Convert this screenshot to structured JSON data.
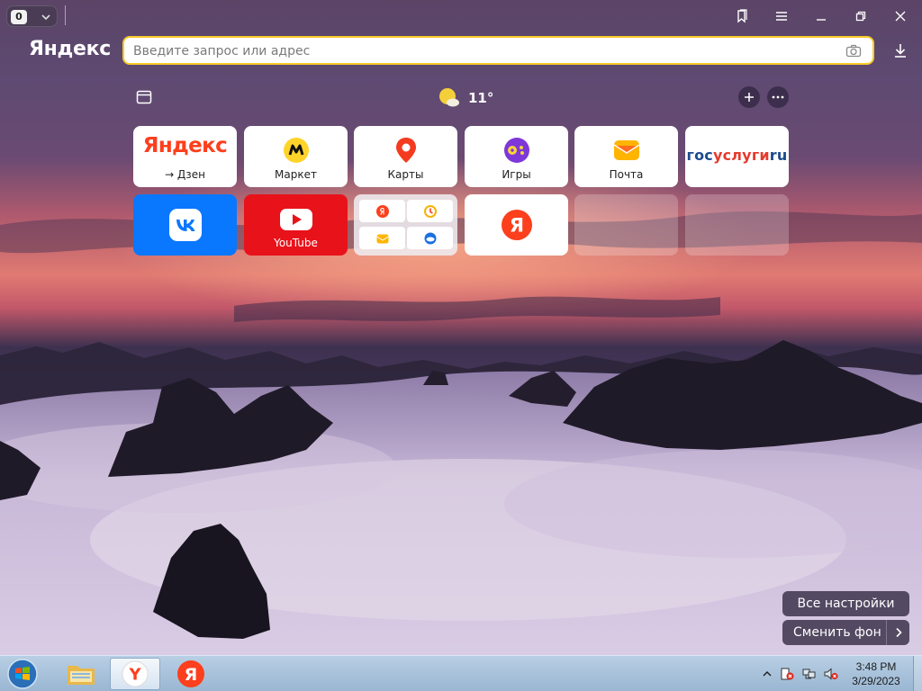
{
  "tab_counter": {
    "count": "0"
  },
  "window_controls": [
    "bookmarks",
    "menu",
    "minimize",
    "restore",
    "close"
  ],
  "header": {
    "brand": "Яндекс",
    "search": {
      "placeholder": "Введите запрос или адрес",
      "value": ""
    }
  },
  "weather": {
    "temperature": "11°",
    "icon": "sun-cloud-icon"
  },
  "tiles": [
    {
      "label": "→ Дзен",
      "logo_text": "Яндекс",
      "icon": "yandex-wordmark"
    },
    {
      "label": "Маркет",
      "icon": "market-icon"
    },
    {
      "label": "Карты",
      "icon": "map-pin-icon"
    },
    {
      "label": "Игры",
      "icon": "gamepad-icon"
    },
    {
      "label": "Почта",
      "icon": "mail-icon"
    },
    {
      "logo_text_a": "гос",
      "logo_text_b": "услуги",
      "logo_text_c": "ru",
      "icon": "gosuslugi-logo"
    },
    {
      "icon": "vk-icon"
    },
    {
      "label": "YouTube",
      "icon": "youtube-icon"
    },
    {
      "icon": "tile-group"
    },
    {
      "logo_text": "Я",
      "icon": "yandex-circle-icon"
    },
    {
      "empty": true
    },
    {
      "empty": true
    }
  ],
  "bottom": {
    "all_settings": "Все настройки",
    "change_bg": "Сменить фон"
  },
  "taskbar": {
    "time": "3:48 PM",
    "date": "3/29/2023",
    "yandex_letter": "Y",
    "pinned_letter": "Я"
  },
  "colors": {
    "accent": "#f6cb2a",
    "vk": "#0a77ff",
    "youtube": "#e8121a",
    "yandex_red": "#fc3f1d"
  }
}
